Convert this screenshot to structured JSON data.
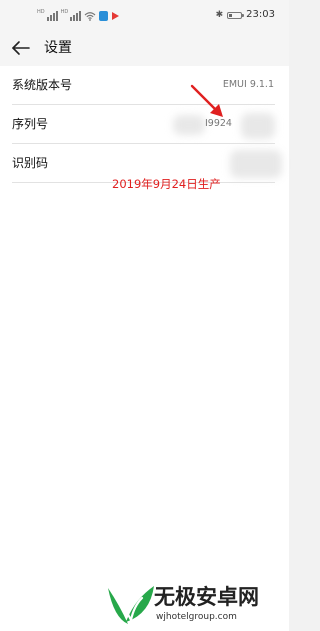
{
  "status_bar": {
    "left_icons": [
      "hd-signal-icon",
      "hd-signal-icon",
      "wifi-icon",
      "app-notification-icon",
      "app-notification-icon"
    ],
    "bluetooth_icon": "bluetooth-icon",
    "battery_icon": "battery-icon",
    "battery_level": 0.3,
    "time": "23:03"
  },
  "header": {
    "back_icon": "arrow-left-icon",
    "title": "设置"
  },
  "rows": [
    {
      "label": "系统版本号",
      "value": "EMUI 9.1.1"
    },
    {
      "label": "序列号",
      "value": "I9924"
    },
    {
      "label": "识别码",
      "value": ""
    }
  ],
  "annotation": {
    "text": "2019年9月24日生产",
    "color": "#e02020"
  },
  "watermark": {
    "logo": "leaf-logo-icon",
    "title": "无极安卓网",
    "url": "wjhotelgroup.com",
    "brand_color": "#27a84a"
  }
}
